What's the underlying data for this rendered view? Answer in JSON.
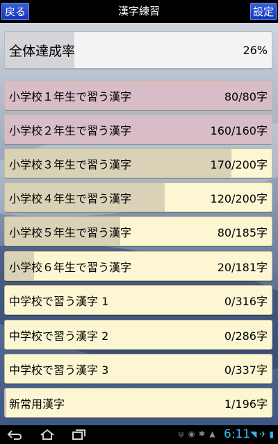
{
  "title_bar": {
    "back_label": "戻る",
    "title": "漢字練習",
    "settings_label": "設定"
  },
  "total": {
    "label": "全体達成率",
    "value": "26%",
    "progress": 0.26
  },
  "rows": [
    {
      "label": "小学校１年生で習う漢字",
      "value": "80/80字",
      "progress": 1.0
    },
    {
      "label": "小学校２年生で習う漢字",
      "value": "160/160字",
      "progress": 1.0
    },
    {
      "label": "小学校３年生で習う漢字",
      "value": "170/200字",
      "progress": 0.85
    },
    {
      "label": "小学校４年生で習う漢字",
      "value": "120/200字",
      "progress": 0.6
    },
    {
      "label": "小学校５年生で習う漢字",
      "value": "80/185字",
      "progress": 0.432
    },
    {
      "label": "小学校６年生で習う漢字",
      "value": "20/181字",
      "progress": 0.11
    },
    {
      "label": "中学校で習う漢字 1",
      "value": "0/316字",
      "progress": 0
    },
    {
      "label": "中学校で習う漢字 2",
      "value": "0/286字",
      "progress": 0
    },
    {
      "label": "中学校で習う漢字 3",
      "value": "0/337字",
      "progress": 0
    },
    {
      "label": "新常用漢字",
      "value": "1/196字",
      "progress": 0.005
    }
  ],
  "system_bar": {
    "clock": "6:11",
    "icons": [
      "back-icon",
      "home-icon",
      "recent-apps-icon",
      "usb-icon",
      "android-icon",
      "debug-icon",
      "notification-icon",
      "wifi-icon",
      "airplane-icon",
      "battery-icon"
    ]
  }
}
